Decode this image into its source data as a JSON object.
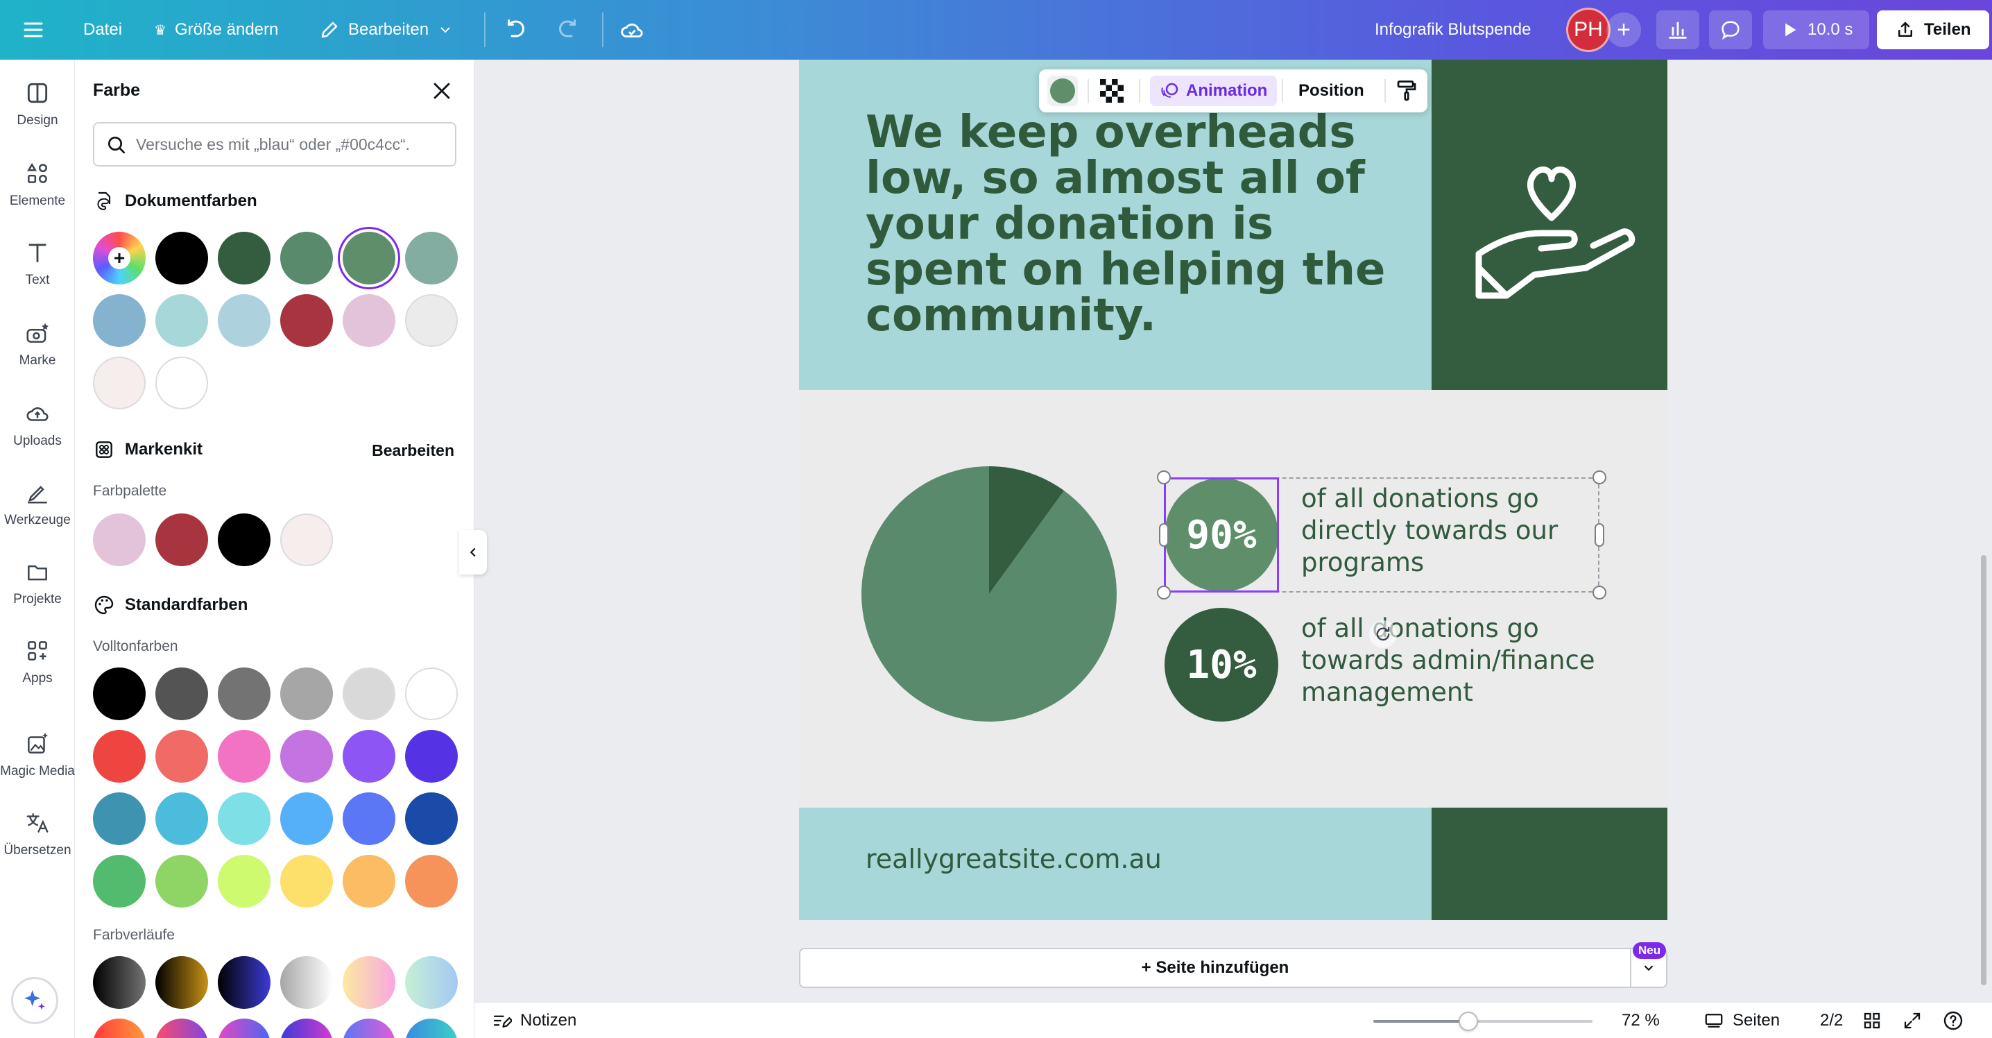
{
  "topbar": {
    "file_label": "Datei",
    "resize_label": "Größe ändern",
    "edit_label": "Bearbeiten",
    "doc_title": "Infografik Blutspende",
    "avatar_initials": "PH",
    "present_label": "10.0 s",
    "share_label": "Teilen"
  },
  "rail": {
    "items": [
      {
        "label": "Design",
        "icon": "design-icon"
      },
      {
        "label": "Elemente",
        "icon": "elements-icon"
      },
      {
        "label": "Text",
        "icon": "text-icon"
      },
      {
        "label": "Marke",
        "icon": "brand-icon"
      },
      {
        "label": "Uploads",
        "icon": "upload-cloud-icon"
      },
      {
        "label": "Werkzeuge",
        "icon": "tools-icon"
      },
      {
        "label": "Projekte",
        "icon": "folder-icon"
      },
      {
        "label": "Apps",
        "icon": "apps-icon"
      },
      {
        "label": "Magic Media",
        "icon": "magic-media-icon"
      },
      {
        "label": "Übersetzen",
        "icon": "translate-icon"
      }
    ]
  },
  "panel": {
    "title": "Farbe",
    "search_placeholder": "Versuche es mit „blau“ oder „#00c4cc“.",
    "document_colors": {
      "heading": "Dokumentfarben",
      "colors": [
        "#000000",
        "#345c3f",
        "#5a8a6c",
        "#5e8f6a",
        "#82ada0",
        "#85b2cf",
        "#a7d7d8",
        "#aed1de",
        "#a83440",
        "#e3c3d9",
        "#ebebeb",
        "#f6eded",
        "#ffffff"
      ],
      "selected_index": 3
    },
    "brand_kit": {
      "heading": "Markenkit",
      "edit_label": "Bearbeiten",
      "palette_label": "Farbpalette",
      "colors": [
        "#e3c3d9",
        "#a83440",
        "#000000",
        "#f6eded"
      ]
    },
    "default_colors": {
      "heading": "Standardfarben",
      "solid_label": "Volltonfarben",
      "solid": [
        "#000000",
        "#545454",
        "#737373",
        "#a6a6a6",
        "#d9d9d9",
        "#ffffff",
        "#ef4540",
        "#f06a66",
        "#f273c4",
        "#c374e0",
        "#8c55f4",
        "#5533e4",
        "#3e94b0",
        "#4cbcdd",
        "#7ce0e6",
        "#56aff9",
        "#5b77f6",
        "#1b4ba8",
        "#52bb6e",
        "#8fd565",
        "#cdfa6e",
        "#fde06c",
        "#fbbc64",
        "#f5935a"
      ],
      "gradient_label": "Farbverläufe"
    }
  },
  "context_toolbar": {
    "animation_label": "Animation",
    "position_label": "Position"
  },
  "canvas": {
    "headline": "We keep overheads low, so almost all of your donation is spent on helping the community.",
    "stat1_value": "90%",
    "stat1_text": "of all donations go directly towards our programs",
    "stat2_value": "10%",
    "stat2_text": "of all donations go towards admin/finance management",
    "website": "reallygreatsite.com.au",
    "colors": {
      "teal": "#a7d7d8",
      "dark_green": "#345c3f",
      "mid_green": "#5a8a6c",
      "light_green": "#5e8f6a",
      "text_green": "#2f5a3c",
      "grey": "#ebebeb"
    }
  },
  "chart_data": {
    "type": "pie",
    "categories": [
      "programs",
      "admin/finance management"
    ],
    "values": [
      90,
      10
    ],
    "colors": [
      "#5a8a6c",
      "#345c3f"
    ]
  },
  "add_page": {
    "label": "+ Seite hinzufügen",
    "badge": "Neu"
  },
  "bottombar": {
    "notes_label": "Notizen",
    "zoom_percent": 72,
    "zoom_label": "72 %",
    "pages_label": "Seiten",
    "page_counter": "2/2"
  }
}
